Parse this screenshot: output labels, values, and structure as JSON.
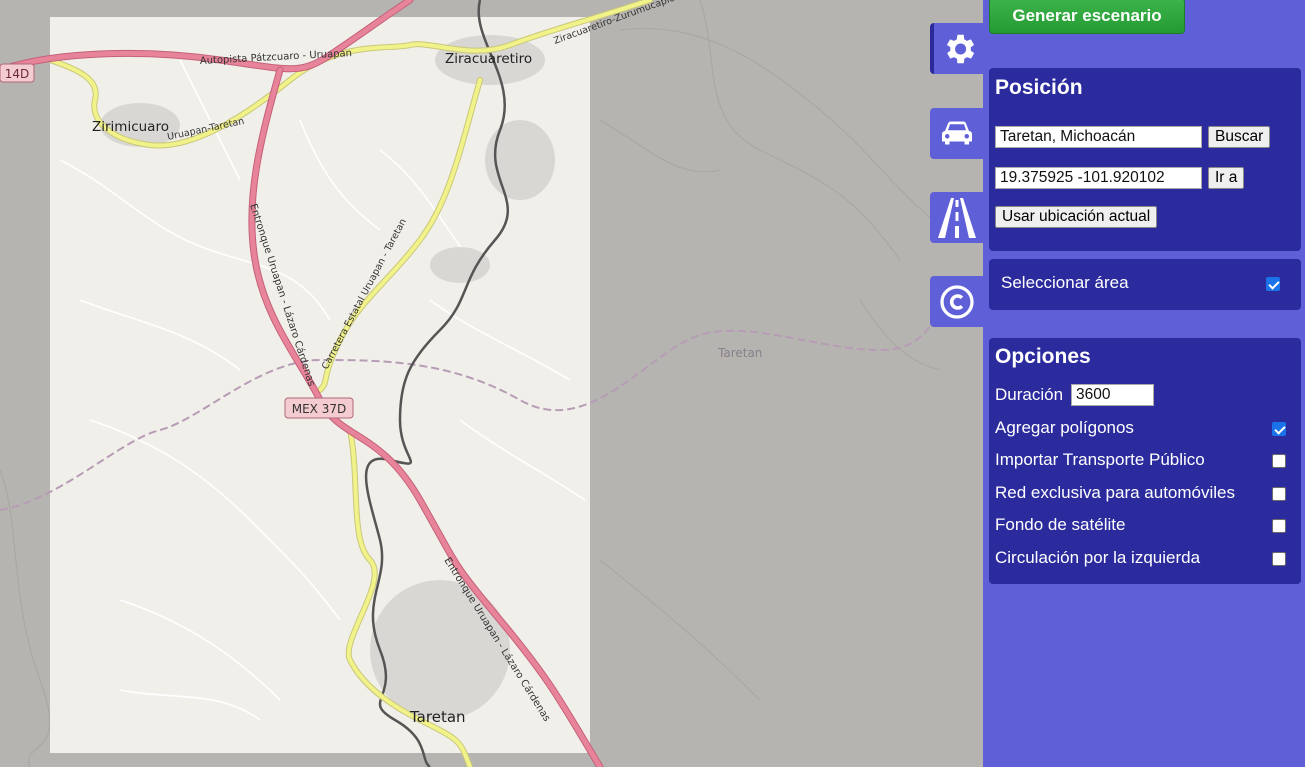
{
  "app": {
    "generate_button": "Generar escenario"
  },
  "colors": {
    "panel_bg": "#5f5fd8",
    "box_bg": "#2b2b9e",
    "generate_green": "#2ea33d",
    "checkbox_blue": "#1a73e8",
    "motorway_pink": "#e8849a",
    "secondary_yellow": "#f2f28a"
  },
  "tabs": [
    {
      "name": "settings",
      "icon": "gear-icon"
    },
    {
      "name": "vehicles",
      "icon": "car-icon"
    },
    {
      "name": "roads",
      "icon": "road-icon"
    },
    {
      "name": "credits",
      "icon": "copyright-icon"
    }
  ],
  "position": {
    "title": "Posición",
    "search_value": "Taretan, Michoacán",
    "search_button": "Buscar",
    "coords_value": "19.375925 -101.920102",
    "goto_button": "Ir a",
    "current_location_button": "Usar ubicación actual"
  },
  "select_area": {
    "label": "Seleccionar área",
    "checked": true
  },
  "options": {
    "title": "Opciones",
    "duration_label": "Duración",
    "duration_value": "3600",
    "items": [
      {
        "label": "Agregar polígonos",
        "checked": true
      },
      {
        "label": "Importar Transporte Público",
        "checked": false
      },
      {
        "label": "Red exclusiva para automóviles",
        "checked": false
      },
      {
        "label": "Fondo de satélite",
        "checked": false
      },
      {
        "label": "Circulación por la izquierda",
        "checked": false
      }
    ]
  },
  "map": {
    "place_labels": [
      "Ziracuaretiro",
      "Zirimicuaro",
      "Taretan",
      "Taretan"
    ],
    "road_labels": [
      "Autopista Pátzcuaro - Uruapan",
      "Uruapan-Taretan",
      "Ziracuaretiro-Zurumucapio",
      "Entronque Uruapan - Lázaro Cárdenas",
      "Carretera Estatal Uruapan - Taretan",
      "Entronque Uruapan - Lázaro Cárdenas"
    ],
    "shields": [
      "14D",
      "MEX 37D"
    ]
  }
}
